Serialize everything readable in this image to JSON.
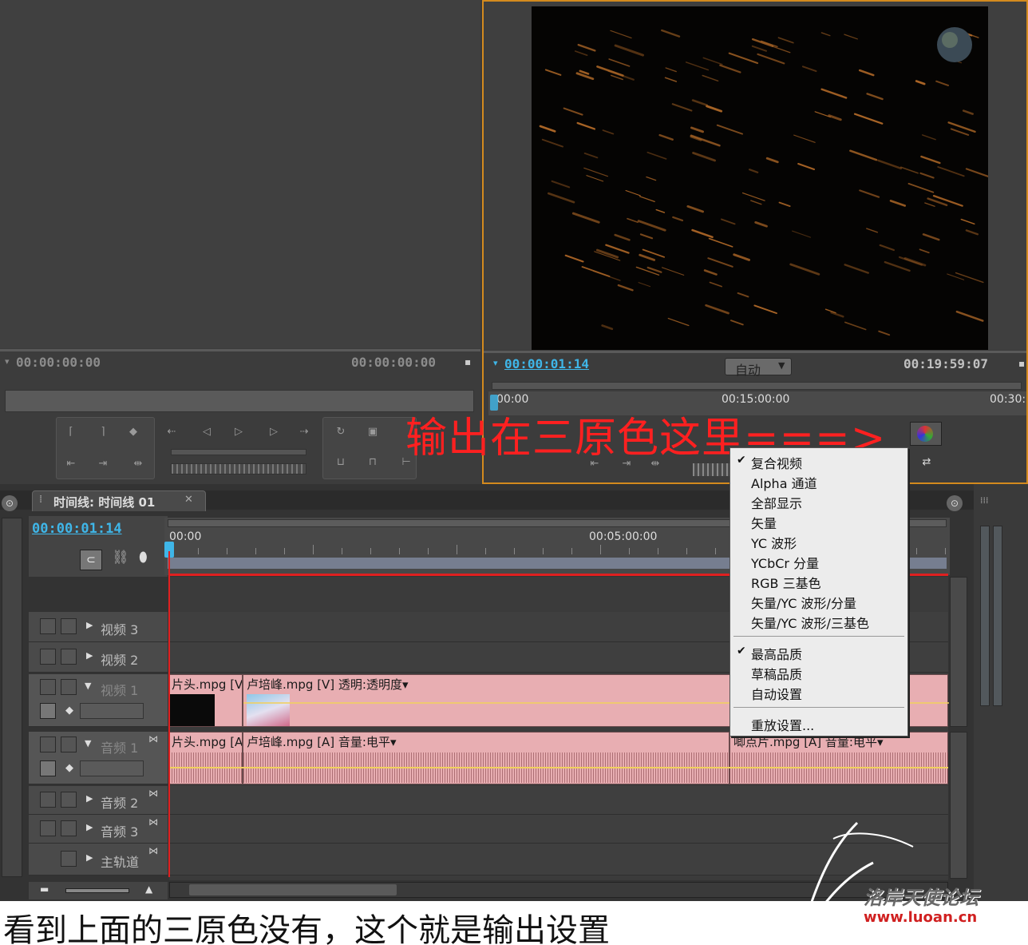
{
  "source_monitor": {
    "timecode_left": "00:00:00:00",
    "timecode_right": "00:00:00:00"
  },
  "program_monitor": {
    "timecode_current": "00:00:01:14",
    "zoom_select": "自动",
    "timecode_duration": "00:19:59:07",
    "ruler_labels": [
      "00:00",
      "00:15:00:00",
      "00:30:"
    ]
  },
  "annotation_overlay": "输出在三原色这里===>",
  "timeline": {
    "tab_title": "时间线: 时间线 01",
    "timecode": "00:00:01:14",
    "ruler_labels": [
      "00:00",
      "00:05:00:00"
    ],
    "tracks": {
      "video3": "视频 3",
      "video2": "视频 2",
      "video1": "视频 1",
      "audio1": "音频 1",
      "audio2": "音频 2",
      "audio3": "音频 3",
      "master": "主轨道"
    },
    "clips": {
      "v_clip1": "片头.mpg [V",
      "v_clip2": "卢培峰.mpg [V] 透明:透明度▾",
      "a_clip1": "片头.mpg [A",
      "a_clip2": "卢培峰.mpg [A] 音量:电平▾",
      "a_clip3": "唧点片.mpg [A] 音量:电平▾"
    }
  },
  "context_menu": {
    "items": [
      {
        "label": "复合视频",
        "checked": true
      },
      {
        "label": "Alpha 通道",
        "checked": false
      },
      {
        "label": "全部显示",
        "checked": false
      },
      {
        "label": "矢量",
        "checked": false
      },
      {
        "label": "YC 波形",
        "checked": false
      },
      {
        "label": "YCbCr 分量",
        "checked": false
      },
      {
        "label": "RGB 三基色",
        "checked": false
      },
      {
        "label": "矢量/YC 波形/分量",
        "checked": false
      },
      {
        "label": "矢量/YC 波形/三基色",
        "checked": false
      }
    ],
    "quality_items": [
      {
        "label": "最高品质",
        "checked": true
      },
      {
        "label": "草稿品质",
        "checked": false
      },
      {
        "label": "自动设置",
        "checked": false
      }
    ],
    "playback_item": "重放设置..."
  },
  "caption": "看到上面的三原色没有，这个就是输出设置",
  "watermark": {
    "name": "洛岸天使论坛",
    "url": "www.luoan.cn"
  },
  "colors": {
    "timecode_blue": "#3fb6e8",
    "clip_pink": "#e8aeb2",
    "annotation_red": "#ff2020",
    "playhead_red": "#e02020",
    "monitor_border_orange": "#d38a1e"
  }
}
